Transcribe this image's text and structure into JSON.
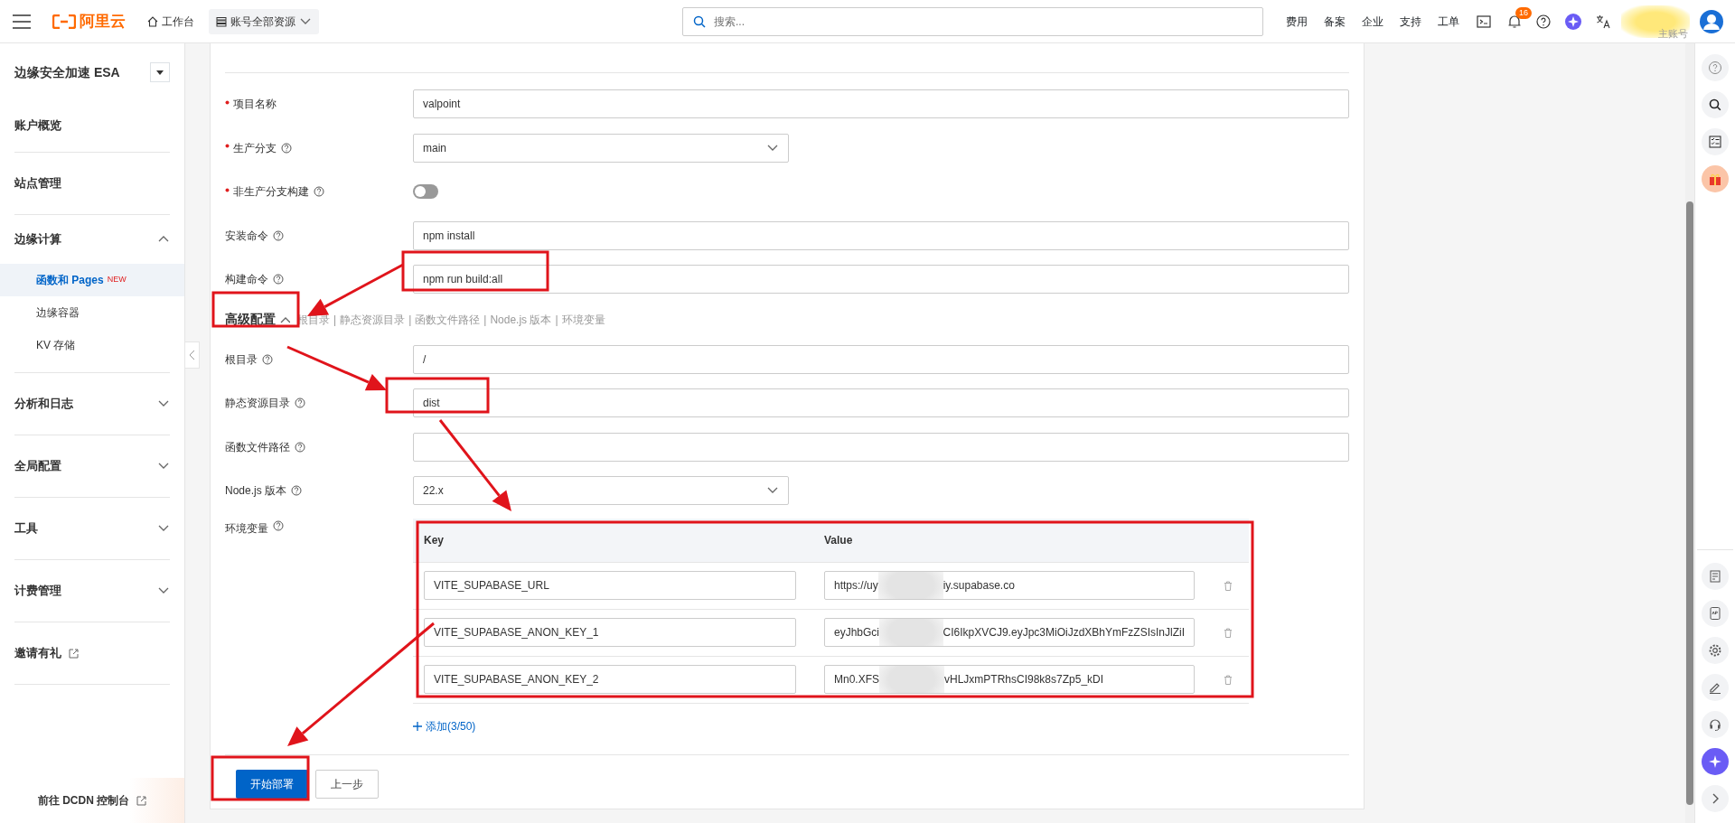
{
  "top_bar": {
    "brand": "阿里云",
    "workbench": "工作台",
    "resource_menu": "账号全部资源",
    "search": {
      "placeholder": "搜索..."
    },
    "links": [
      "费用",
      "备案",
      "企业",
      "支持",
      "工单"
    ],
    "notification_count": "16",
    "account_role": "主账号"
  },
  "sidebar": {
    "title": "边缘安全加速 ESA",
    "sections": [
      {
        "label": "账户概览"
      },
      {
        "label": "站点管理"
      },
      {
        "label": "边缘计算",
        "expanded": true,
        "children": [
          {
            "label": "函数和 Pages",
            "badge": "NEW",
            "selected": true
          },
          {
            "label": "边缘容器",
            "selected": false
          },
          {
            "label": "KV 存储",
            "selected": false
          }
        ]
      },
      {
        "label": "分析和日志",
        "expanded": false
      },
      {
        "label": "全局配置",
        "expanded": false
      },
      {
        "label": "工具",
        "expanded": false
      },
      {
        "label": "计费管理",
        "expanded": false
      },
      {
        "label": "邀请有礼",
        "external": true
      }
    ],
    "footer": "前往 DCDN 控制台"
  },
  "form": {
    "fields": [
      {
        "kind": "text",
        "label": "项目名称",
        "required": true,
        "help": false,
        "value": "valpoint"
      },
      {
        "kind": "select",
        "label": "生产分支",
        "required": true,
        "help": true,
        "value": "main"
      },
      {
        "kind": "toggle",
        "label": "非生产分支构建",
        "required": true,
        "help": true,
        "on": false
      },
      {
        "kind": "text",
        "label": "安装命令",
        "required": false,
        "help": true,
        "value": "npm install"
      },
      {
        "kind": "text",
        "label": "构建命令",
        "required": false,
        "help": true,
        "value": "npm run build:all"
      }
    ],
    "advanced": {
      "title": "高级配置",
      "expanded": true,
      "shortcuts": [
        "根目录",
        "静态资源目录",
        "函数文件路径",
        "Node.js 版本",
        "环境变量"
      ],
      "separator": "|"
    },
    "advanced_fields": [
      {
        "kind": "text",
        "label": "根目录",
        "required": false,
        "help": true,
        "value": "/"
      },
      {
        "kind": "text",
        "label": "静态资源目录",
        "required": false,
        "help": true,
        "value": "dist"
      },
      {
        "kind": "text",
        "label": "函数文件路径",
        "required": false,
        "help": true
      },
      {
        "kind": "select",
        "label": "Node.js 版本",
        "required": false,
        "help": true,
        "value": "22.x"
      }
    ],
    "env": {
      "label": "环境变量",
      "columns": [
        "Key",
        "Value"
      ],
      "rows": [
        {
          "key": "VITE_SUPABASE_URL",
          "value_start": "https://uy",
          "value_end": "iy.supabase.co"
        },
        {
          "key": "VITE_SUPABASE_ANON_KEY_1",
          "value_start": "eyJhbGci",
          "value_end": "CI6IkpXVCJ9.eyJpc3MiOiJzdXBhYmFzZSIsInJlZiI"
        },
        {
          "key": "VITE_SUPABASE_ANON_KEY_2",
          "value_start": "Mn0.XFS",
          "value_end": "vHLJxmPTRhsCI98k8s7Zp5_kDI"
        }
      ],
      "add": "添加(3/50)"
    },
    "buttons": {
      "primary": "开始部署",
      "secondary": "上一步"
    }
  }
}
